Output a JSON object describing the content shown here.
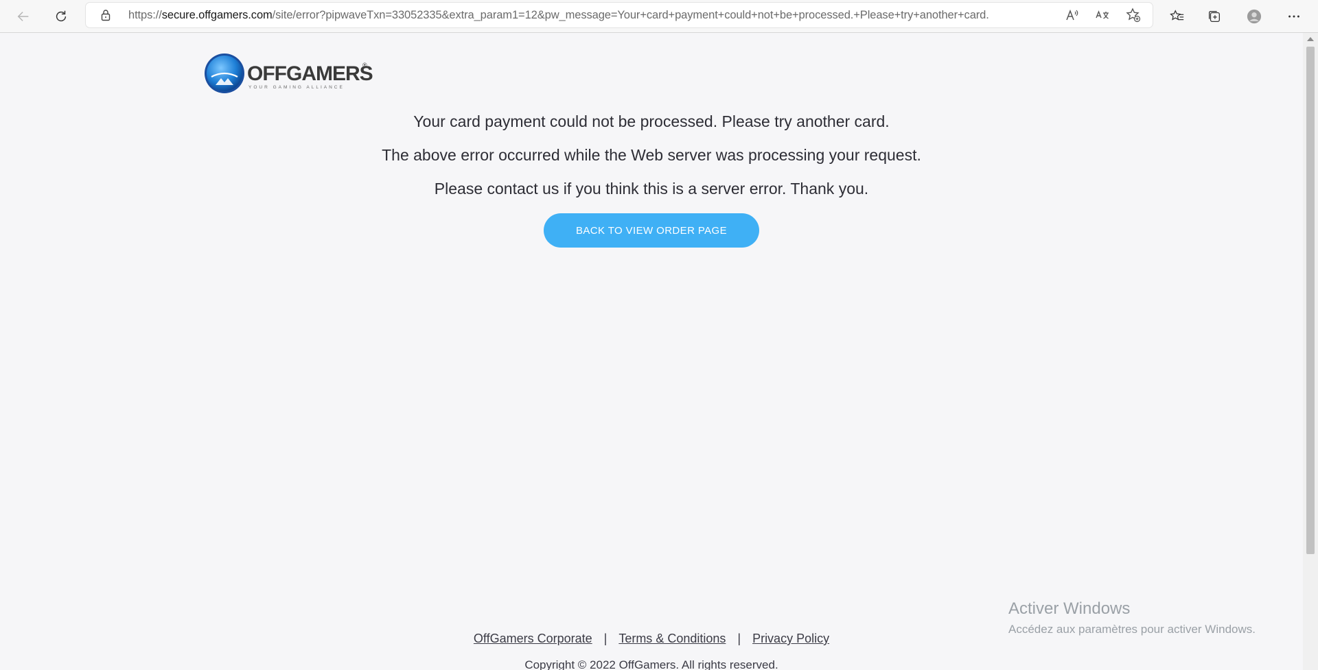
{
  "browser": {
    "url_prefix": "https://",
    "url_host": "secure.offgamers.com",
    "url_rest": "/site/error?pipwaveTxn=33052335&extra_param1=12&pw_message=Your+card+payment+could+not+be+processed.+Please+try+another+card.",
    "icons": [
      "back-icon",
      "refresh-icon",
      "lock-icon",
      "read-aloud-icon",
      "translate-icon",
      "add-favorite-icon",
      "favorites-icon",
      "collections-icon",
      "profile-icon",
      "more-icon"
    ]
  },
  "page": {
    "logo_text": "OFFGAMERS",
    "logo_tagline": "YOUR GAMING ALLIANCE",
    "messages": [
      "Your card payment could not be processed. Please try another card.",
      "The above error occurred while the Web server was processing your request.",
      "Please contact us if you think this is a server error. Thank you."
    ],
    "back_button": "BACK TO VIEW ORDER PAGE",
    "accent_color": "#3fb0f5"
  },
  "footer": {
    "links": [
      "OffGamers Corporate",
      "Terms & Conditions",
      "Privacy Policy"
    ],
    "separator": "|",
    "copyright": "Copyright © 2022 OffGamers. All rights reserved."
  },
  "watermark": {
    "title": "Activer Windows",
    "subtitle": "Accédez aux paramètres pour activer Windows."
  }
}
